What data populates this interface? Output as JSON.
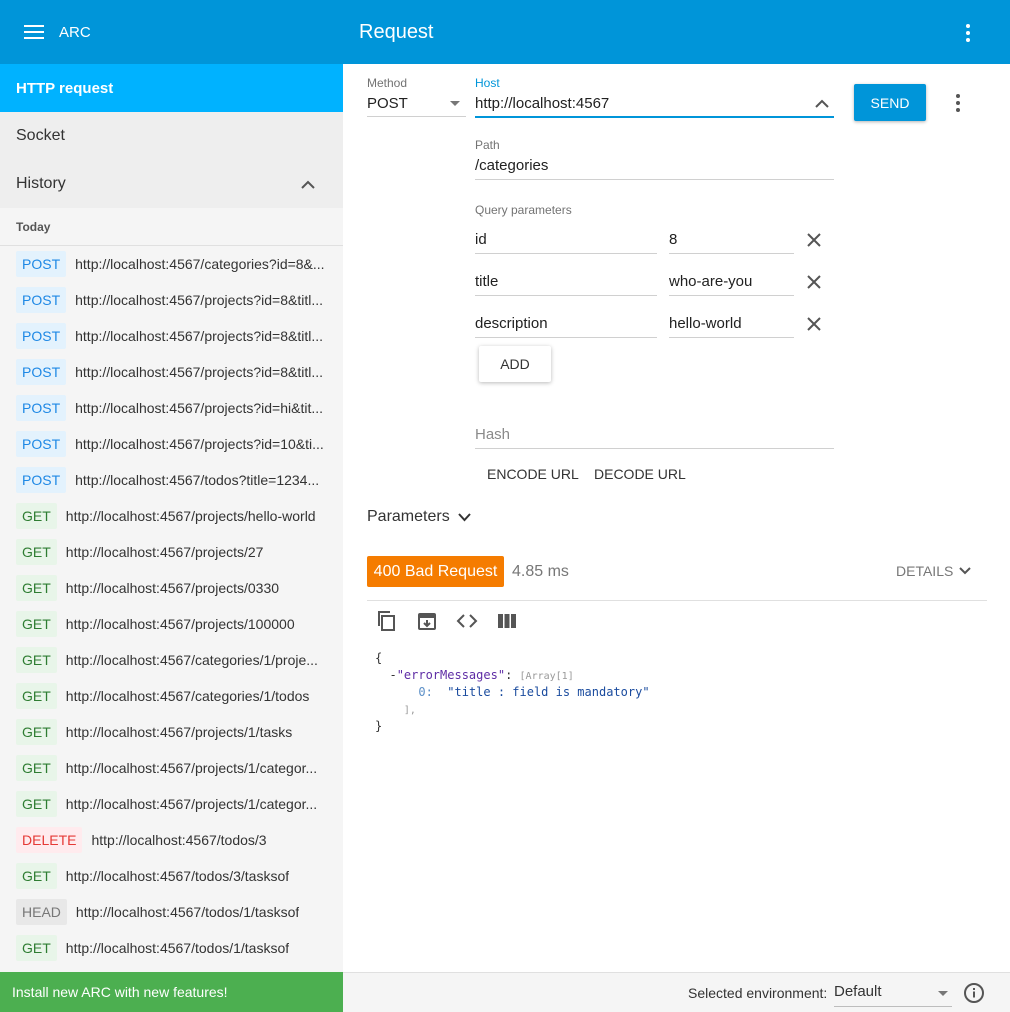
{
  "sidebar": {
    "app_name": "ARC",
    "nav": {
      "http_request": "HTTP request",
      "socket": "Socket",
      "history": "History"
    },
    "today_label": "Today",
    "history_items": [
      {
        "method": "POST",
        "url": "http://localhost:4567/categories?id=8&..."
      },
      {
        "method": "POST",
        "url": "http://localhost:4567/projects?id=8&titl..."
      },
      {
        "method": "POST",
        "url": "http://localhost:4567/projects?id=8&titl..."
      },
      {
        "method": "POST",
        "url": "http://localhost:4567/projects?id=8&titl..."
      },
      {
        "method": "POST",
        "url": "http://localhost:4567/projects?id=hi&tit..."
      },
      {
        "method": "POST",
        "url": "http://localhost:4567/projects?id=10&ti..."
      },
      {
        "method": "POST",
        "url": "http://localhost:4567/todos?title=1234..."
      },
      {
        "method": "GET",
        "url": "http://localhost:4567/projects/hello-world"
      },
      {
        "method": "GET",
        "url": "http://localhost:4567/projects/27"
      },
      {
        "method": "GET",
        "url": "http://localhost:4567/projects/0330"
      },
      {
        "method": "GET",
        "url": "http://localhost:4567/projects/100000"
      },
      {
        "method": "GET",
        "url": "http://localhost:4567/categories/1/proje..."
      },
      {
        "method": "GET",
        "url": "http://localhost:4567/categories/1/todos"
      },
      {
        "method": "GET",
        "url": "http://localhost:4567/projects/1/tasks"
      },
      {
        "method": "GET",
        "url": "http://localhost:4567/projects/1/categor..."
      },
      {
        "method": "GET",
        "url": "http://localhost:4567/projects/1/categor..."
      },
      {
        "method": "DELETE",
        "url": "http://localhost:4567/todos/3"
      },
      {
        "method": "GET",
        "url": "http://localhost:4567/todos/3/tasksof"
      },
      {
        "method": "HEAD",
        "url": "http://localhost:4567/todos/1/tasksof"
      },
      {
        "method": "GET",
        "url": "http://localhost:4567/todos/1/tasksof"
      }
    ],
    "promo": "Install new ARC with new features!"
  },
  "header": {
    "title": "Request"
  },
  "request": {
    "method_label": "Method",
    "method_value": "POST",
    "host_label": "Host",
    "host_value": "http://localhost:4567",
    "send_label": "SEND",
    "path_label": "Path",
    "path_value": "/categories",
    "query_label": "Query parameters",
    "query_params": [
      {
        "name": "id",
        "value": "8"
      },
      {
        "name": "title",
        "value": "who-are-you"
      },
      {
        "name": "description",
        "value": "hello-world"
      }
    ],
    "add_label": "ADD",
    "hash_placeholder": "Hash",
    "encode_label": "ENCODE URL",
    "decode_label": "DECODE URL",
    "parameters_label": "Parameters"
  },
  "response": {
    "status": "400 Bad Request",
    "status_color": "#f57c00",
    "time": "4.85 ms",
    "details_label": "DETAILS",
    "json": {
      "open": "{",
      "key": "\"errorMessages\"",
      "colon": ":",
      "meta": "[Array[1]",
      "index": "0:",
      "value": "\"title : field is mandatory\"",
      "close_array": "],",
      "close": "}"
    }
  },
  "footer": {
    "env_label": "Selected environment:",
    "env_value": "Default"
  },
  "colors": {
    "header_blue": "#0095d9",
    "active_nav": "#00b2ff",
    "promo_green": "#4caf50"
  }
}
